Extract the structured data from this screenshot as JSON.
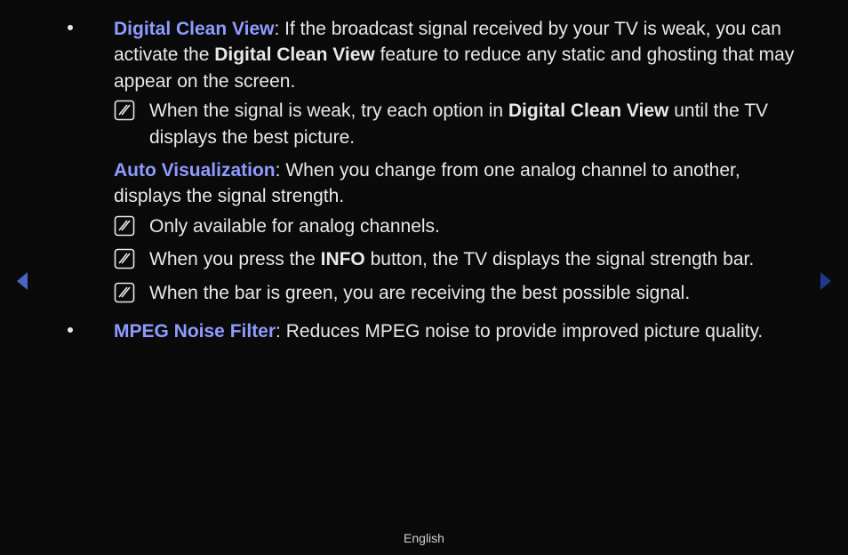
{
  "colors": {
    "background": "#0a0a0a",
    "text": "#e8e8e8",
    "accent": "#8f9bff",
    "arrow_prev": "#4766c7",
    "arrow_next": "#1f3a8a"
  },
  "icons": {
    "note": "note-icon",
    "prev": "triangle-left",
    "next": "triangle-right"
  },
  "nav": {
    "prev_label": "Previous",
    "next_label": "Next"
  },
  "footer": {
    "language": "English"
  },
  "items": [
    {
      "term": "Digital Clean View",
      "separator": ": ",
      "desc_pre": "If the broadcast signal received by your TV is weak, you can activate the ",
      "desc_bold": "Digital Clean View",
      "desc_post": " feature to reduce any static and ghosting that may appear on the screen.",
      "notes": [
        {
          "pre": "When the signal is weak, try each option in ",
          "bold": "Digital Clean View",
          "post": " until the TV displays the best picture."
        }
      ],
      "sub": {
        "term": "Auto Visualization",
        "separator": ": ",
        "desc": "When you change from one analog channel to another, displays the signal strength.",
        "notes": [
          {
            "pre": "Only available for analog channels.",
            "bold": "",
            "post": ""
          },
          {
            "pre": "When you press the ",
            "bold": "INFO",
            "post": " button, the TV displays the signal strength bar."
          },
          {
            "pre": "When the bar is green, you are receiving the best possible signal.",
            "bold": "",
            "post": ""
          }
        ]
      }
    },
    {
      "term": "MPEG Noise Filter",
      "separator": ": ",
      "desc": "Reduces MPEG noise to provide improved picture quality."
    }
  ]
}
